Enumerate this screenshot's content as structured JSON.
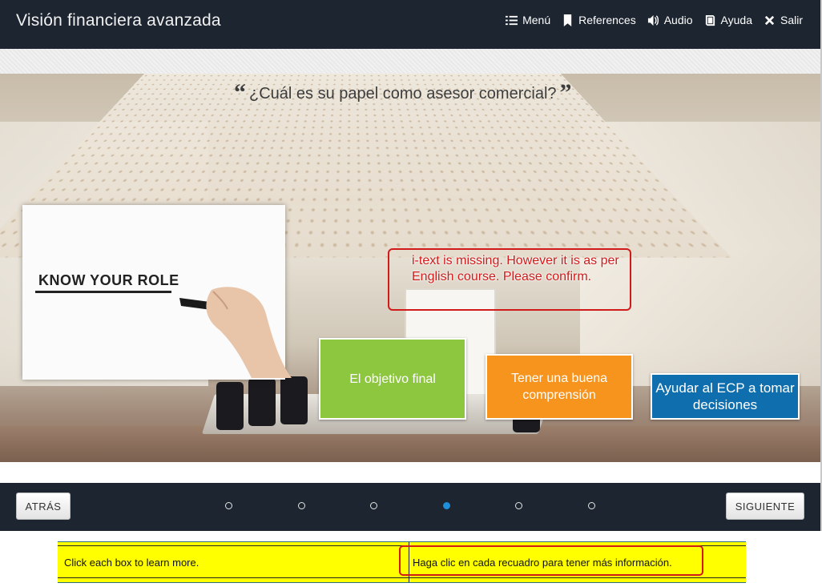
{
  "header": {
    "title": "Visión financiera avanzada",
    "nav": [
      {
        "label": "Menú",
        "icon": "list-icon"
      },
      {
        "label": "References",
        "icon": "bookmark-icon"
      },
      {
        "label": "Audio",
        "icon": "speaker-icon"
      },
      {
        "label": "Ayuda",
        "icon": "book-icon"
      },
      {
        "label": "Salir",
        "icon": "close-icon"
      }
    ]
  },
  "slide": {
    "question": "¿Cuál es su papel como asesor comercial?",
    "quote_open": "“",
    "quote_close": "”",
    "image_text": "KNOW YOUR ROLE",
    "annotation": "i-text is missing. However it is as per English course. Please confirm.",
    "boxes": [
      {
        "label": "El objetivo final",
        "color": "#8dc63f"
      },
      {
        "label": "Tener una buena comprensión",
        "color": "#f7941d"
      },
      {
        "label": "Ayudar al ECP a tomar decisiones",
        "color": "#0f6fae"
      }
    ]
  },
  "footer": {
    "back_label": "ATRÁS",
    "next_label": "SIGUIENTE",
    "pagination": {
      "total": 6,
      "current": 4
    }
  },
  "subtitles": {
    "english": "Click each box to learn more.",
    "spanish": "Haga clic en cada recuadro para tener más información."
  }
}
